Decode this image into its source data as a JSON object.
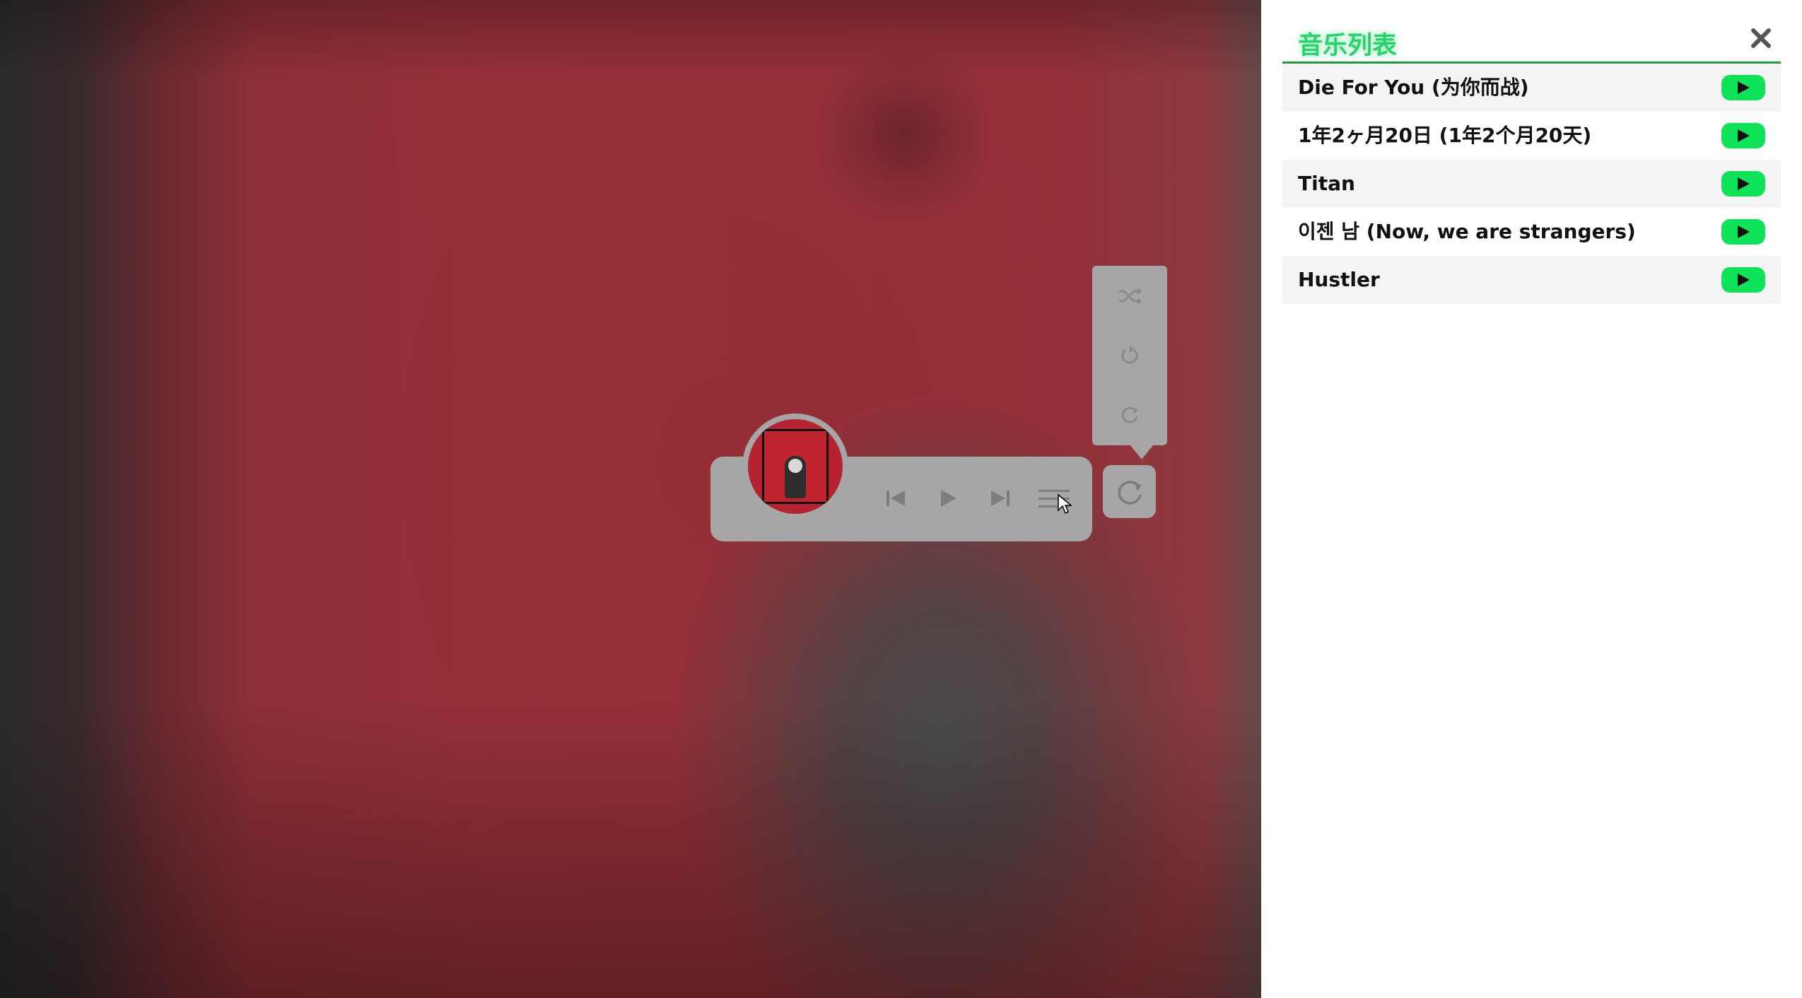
{
  "window": {
    "background": "blurred album art"
  },
  "player": {
    "album_art_icon": "album-cover",
    "controls": [
      {
        "name": "prev-icon",
        "icon": "skip-previous"
      },
      {
        "name": "play-icon",
        "icon": "play"
      },
      {
        "name": "next-icon",
        "icon": "skip-next"
      },
      {
        "name": "playlist-icon",
        "icon": "menu-lines"
      }
    ],
    "mode_button_icon": "repeat-circle",
    "mode_options": [
      {
        "name": "shuffle-icon",
        "icon": "shuffle"
      },
      {
        "name": "loop-one-icon",
        "icon": "loop-single"
      },
      {
        "name": "loop-all-icon",
        "icon": "loop-all"
      }
    ],
    "panel_color": "#a6a6a6"
  },
  "playlist": {
    "title": "音乐列表",
    "close_icon": "close-x",
    "accent_color": "#27d36b",
    "play_button_color": "#0fe35a",
    "songs": [
      {
        "title": "Die For You (为你而战)"
      },
      {
        "title": "1年2ヶ月20日 (1年2个月20天)"
      },
      {
        "title": "Titan"
      },
      {
        "title": "이젠 남 (Now, we are strangers)"
      },
      {
        "title": "Hustler"
      }
    ]
  }
}
